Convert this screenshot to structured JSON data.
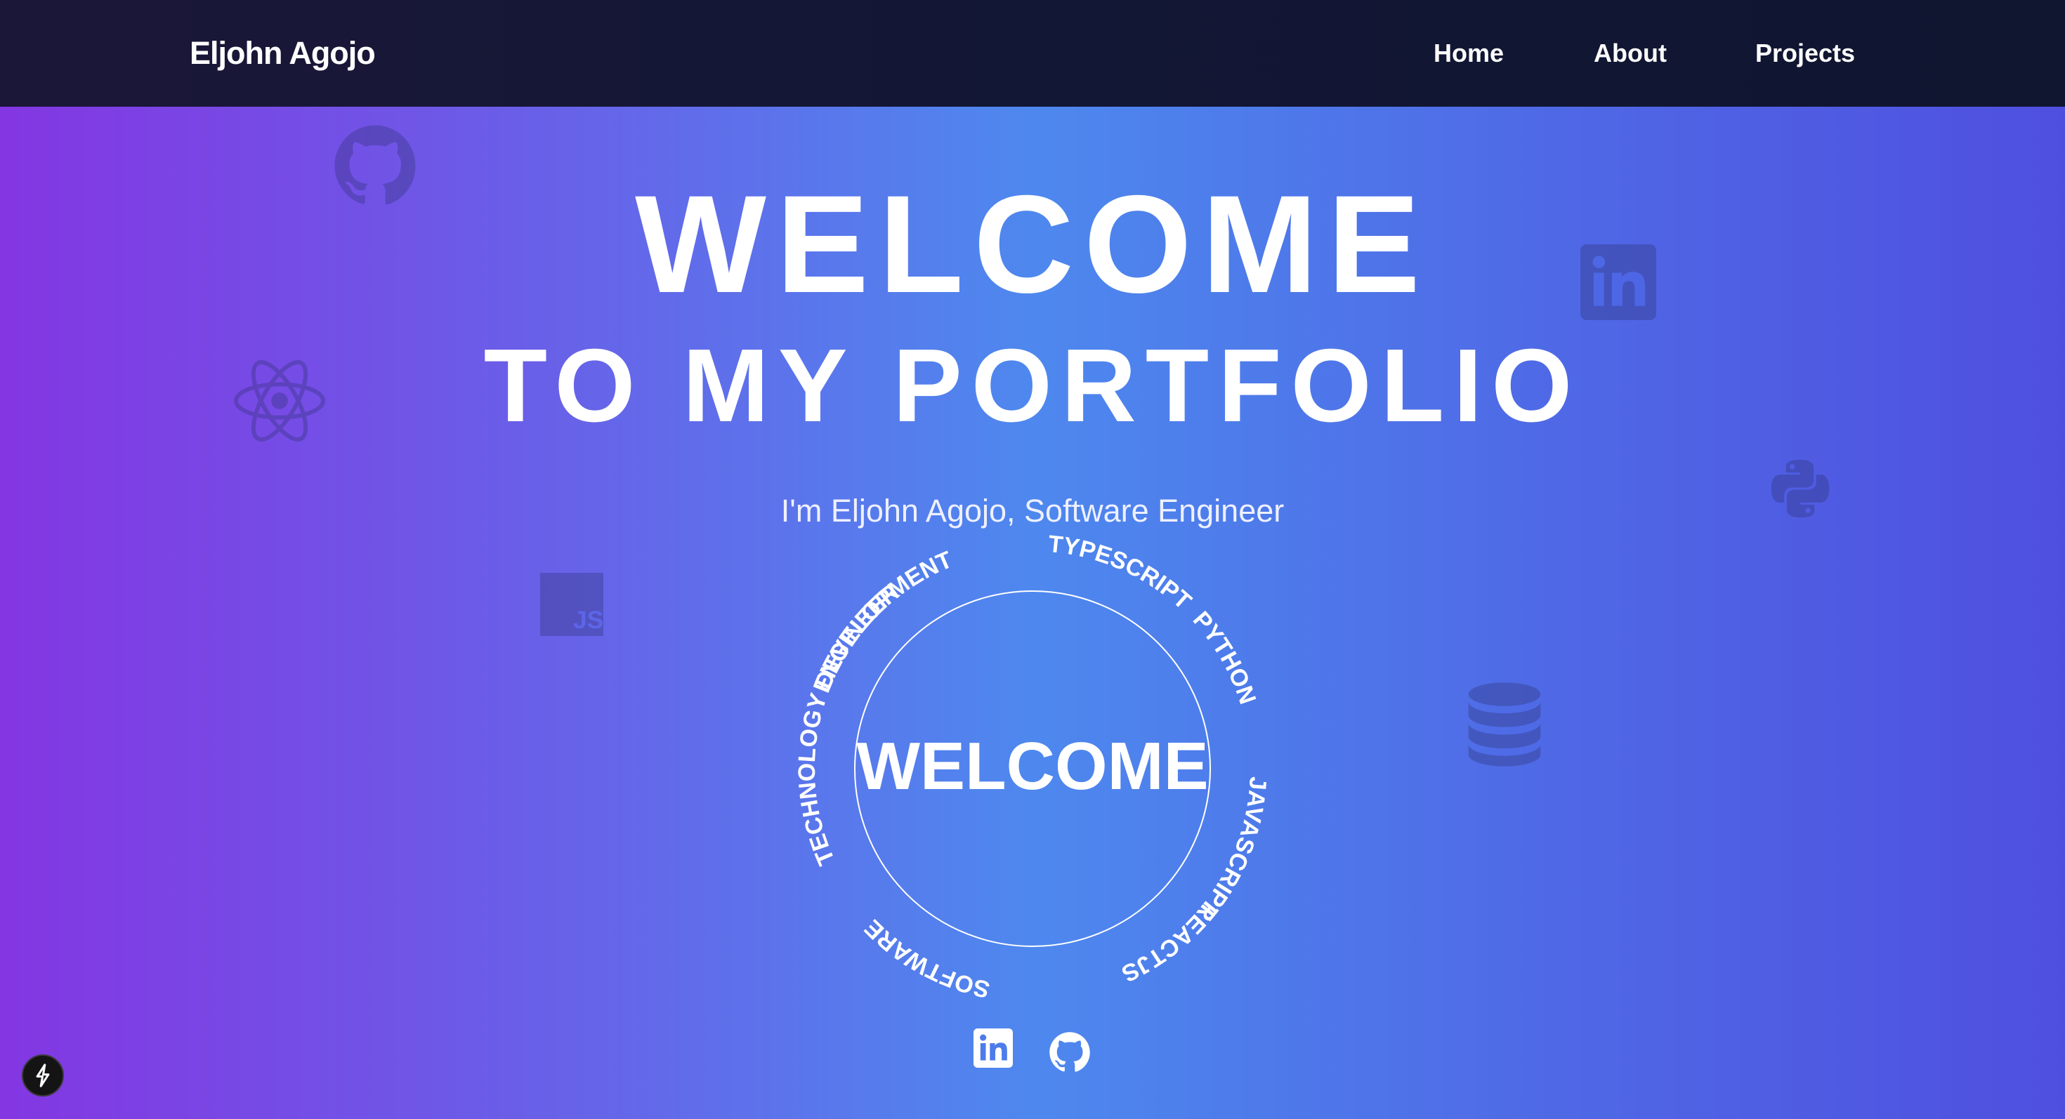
{
  "header": {
    "brand": "Eljohn Agojo",
    "nav": [
      {
        "label": "Home"
      },
      {
        "label": "About"
      },
      {
        "label": "Projects"
      }
    ]
  },
  "hero": {
    "title_line1": "WELCOME",
    "title_line2": "TO MY PORTFOLIO",
    "subtitle": "I'm Eljohn Agojo, Software Engineer"
  },
  "ring": {
    "center_text": "WELCOME",
    "words": [
      "DEVELOPMENT",
      "TYPESCRIPT",
      "PYTHON",
      "JAVASCRIPT",
      "REACTJS",
      "SOFTWARE",
      "TECHNOLOGY",
      "ENGINEER"
    ]
  },
  "background_icons": [
    "github-icon",
    "linkedin-icon",
    "react-icon",
    "python-icon",
    "javascript-icon",
    "database-icon"
  ],
  "social_links": [
    "linkedin-icon",
    "github-icon"
  ],
  "colors": {
    "gradient_left": "#8336e2",
    "gradient_mid": "#4e88ee",
    "gradient_right": "#4f4fdf",
    "navbar": "#121735",
    "text": "#ffffff",
    "bg_icon": "#2a3a7a"
  }
}
